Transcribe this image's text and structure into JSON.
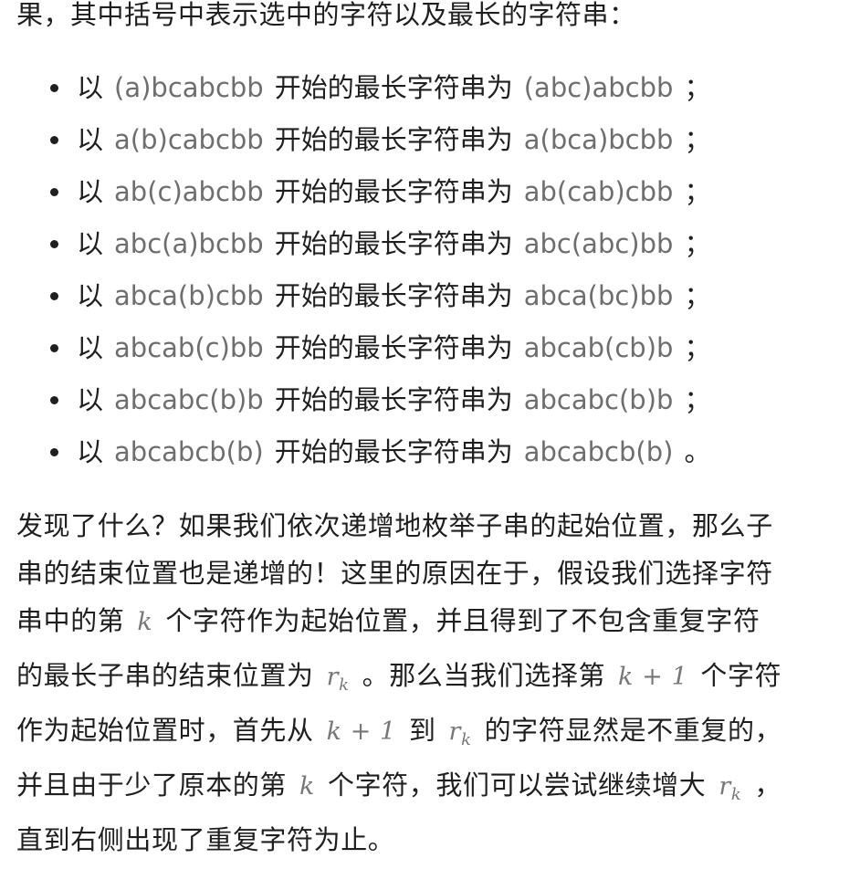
{
  "intro": "果，其中括号中表示选中的字符以及最长的字符串：",
  "bullets": [
    {
      "prefix": "以",
      "start": "(a)bcabcbb",
      "middle": "开始的最长字符串为",
      "result": "(abc)abcbb",
      "end": "；"
    },
    {
      "prefix": "以",
      "start": "a(b)cabcbb",
      "middle": "开始的最长字符串为",
      "result": "a(bca)bcbb",
      "end": "；"
    },
    {
      "prefix": "以",
      "start": "ab(c)abcbb",
      "middle": "开始的最长字符串为",
      "result": "ab(cab)cbb",
      "end": "；"
    },
    {
      "prefix": "以",
      "start": "abc(a)bcbb",
      "middle": "开始的最长字符串为",
      "result": "abc(abc)bb",
      "end": "；"
    },
    {
      "prefix": "以",
      "start": "abca(b)cbb",
      "middle": "开始的最长字符串为",
      "result": "abca(bc)bb",
      "end": "；"
    },
    {
      "prefix": "以",
      "start": "abcab(c)bb",
      "middle": "开始的最长字符串为",
      "result": "abcab(cb)b",
      "end": "；"
    },
    {
      "prefix": "以",
      "start": "abcabc(b)b",
      "middle": "开始的最长字符串为",
      "result": "abcabc(b)b",
      "end": "；"
    },
    {
      "prefix": "以",
      "start": "abcabcb(b)",
      "middle": "开始的最长字符串为",
      "result": "abcabcb(b)",
      "end": "。"
    }
  ],
  "paragraph": {
    "l1": "发现了什么？如果我们依次递增地枚举子串的起始位置，那么子",
    "l2": "串的结束位置也是递增的！这里的原因在于，假设我们选择字符",
    "l3a": "串中的第",
    "l3b": "个字符作为起始位置，并且得到了不包含重复字符",
    "l4a": "的最长子串的结束位置为",
    "l4b": "。那么当我们选择第",
    "l4c": "个字符",
    "l5a": "作为起始位置时，首先从",
    "l5b": "到",
    "l5c": "的字符显然是不重复的，",
    "l6a": "并且由于少了原本的第",
    "l6b": "个字符，我们可以尝试继续增大",
    "l6c": "，",
    "l7": "直到右侧出现了重复字符为止。"
  },
  "math": {
    "k": "k",
    "r": "r",
    "r_sub": "k",
    "k_plus_1": "k + 1"
  }
}
